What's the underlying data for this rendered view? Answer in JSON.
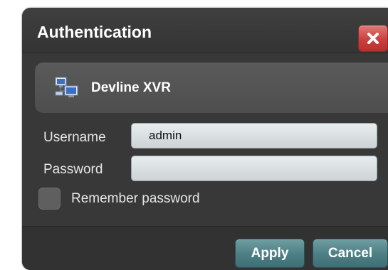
{
  "dialog": {
    "title": "Authentication",
    "close_icon": "close-icon",
    "server": {
      "icon": "network-computers-icon",
      "name": "Devline XVR"
    },
    "form": {
      "username_label": "Username",
      "username_value": "admin",
      "password_label": "Password",
      "password_value": "",
      "remember_label": "Remember password",
      "remember_checked": false
    },
    "buttons": {
      "apply_label": "Apply",
      "cancel_label": "Cancel"
    }
  },
  "colors": {
    "dialog_bg": "#3a3a3a",
    "close_button": "#c9413f",
    "action_button": "#4c7e83"
  }
}
